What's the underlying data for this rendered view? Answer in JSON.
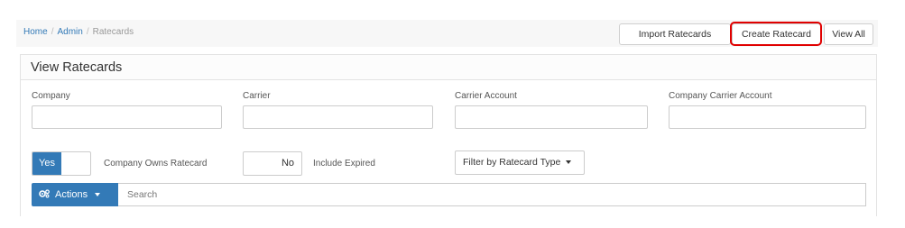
{
  "breadcrumb": {
    "home": "Home",
    "admin": "Admin",
    "current": "Ratecards"
  },
  "toolbar": {
    "import_label": "Import Ratecards",
    "create_label": "Create Ratecard",
    "view_all_label": "View All"
  },
  "panel": {
    "title": "View Ratecards"
  },
  "filters": {
    "company_label": "Company",
    "company_value": "",
    "carrier_label": "Carrier",
    "carrier_value": "",
    "carrier_account_label": "Carrier Account",
    "carrier_account_value": "",
    "company_carrier_account_label": "Company Carrier Account",
    "company_carrier_account_value": ""
  },
  "toggles": {
    "company_owns": {
      "state": "Yes",
      "label": "Company Owns Ratecard"
    },
    "include_expired": {
      "state": "No",
      "label": "Include Expired"
    }
  },
  "ratecard_type_select": {
    "label": "Filter by Ratecard Type"
  },
  "actions": {
    "label": "Actions",
    "icon": "gears-icon"
  },
  "search": {
    "placeholder": "Search"
  },
  "colors": {
    "primary": "#337ab7",
    "highlight": "#e00000"
  }
}
